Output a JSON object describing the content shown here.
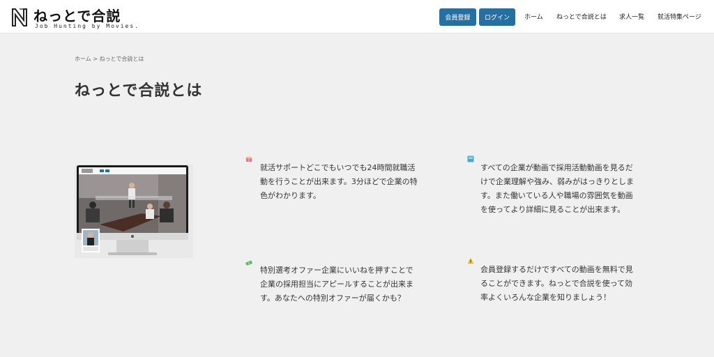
{
  "header": {
    "logo_title": "ねっとで合説",
    "logo_subtitle": "Job Hunting by Movies.",
    "register_label": "会員登録",
    "login_label": "ログイン",
    "nav": [
      {
        "label": "ホーム"
      },
      {
        "label": "ねっとで合説とは"
      },
      {
        "label": "求人一覧"
      },
      {
        "label": "就活特集ページ"
      }
    ]
  },
  "breadcrumb": {
    "home": "ホーム",
    "separator": ">",
    "current": "ねっとで合説とは"
  },
  "page_title": "ねっとで合説とは",
  "features": [
    {
      "icon": "gift-icon",
      "text": "就活サポートどこでもいつでも24時間就職活動を行うことが出来ます。3分ほどで企業の特色がわかります。"
    },
    {
      "icon": "notebook-icon",
      "text": "すべての企業が動画で採用活動動画を見るだけで企業理解や強み、弱みがはっきりとします。また働いている人や職場の雰囲気を動画を使ってより詳細に見ることが出来ます。"
    },
    {
      "icon": "money-icon",
      "text": "特別選考オファー企業にいいねを押すことで企業の採用担当にアピールすることが出来ます。あなたへの特別オファーが届くかも？"
    },
    {
      "icon": "warning-icon",
      "text": "会員登録するだけですべての動画を無料で見ることができます。ねっとで合説を使って効率よくいろんな企業を知りましょう！"
    }
  ],
  "colors": {
    "accent": "#266fa3",
    "background": "#f0f0f0",
    "header_bg": "#ffffff",
    "text": "#333333"
  }
}
